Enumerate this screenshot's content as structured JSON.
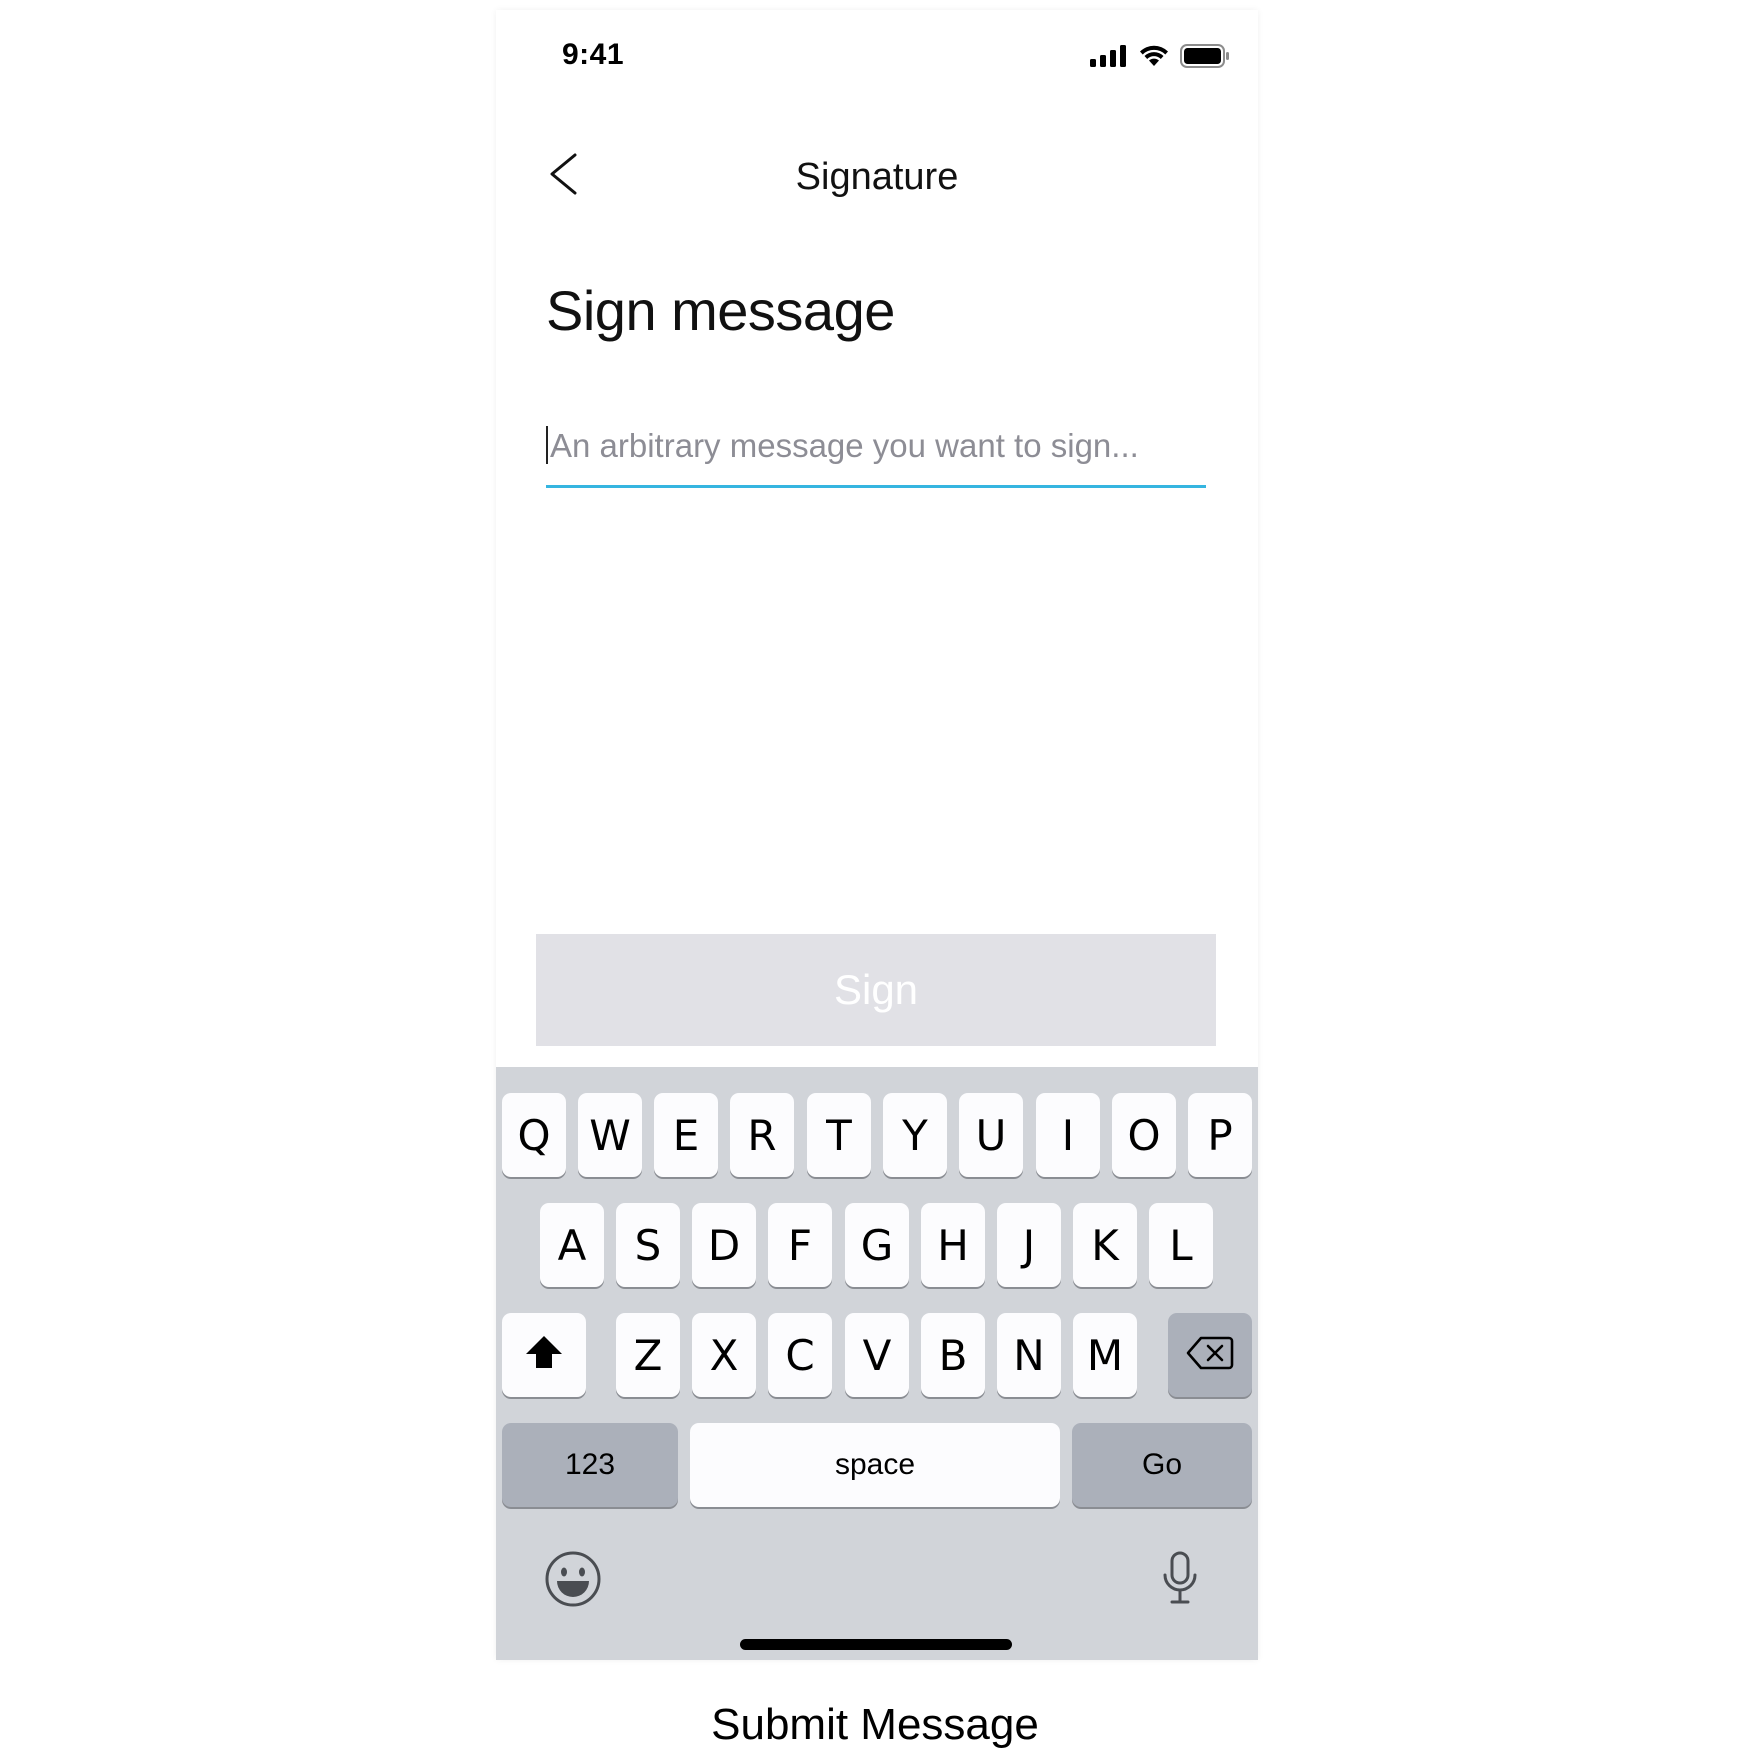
{
  "status_bar": {
    "time": "9:41",
    "icons": [
      "signal-icon",
      "wifi-icon",
      "battery-icon"
    ]
  },
  "nav": {
    "back_icon": "chevron-left-icon",
    "title": "Signature"
  },
  "page": {
    "heading": "Sign message"
  },
  "message_input": {
    "value": "",
    "placeholder": "An arbitrary message you want to sign..."
  },
  "sign_button": {
    "label": "Sign",
    "disabled": true
  },
  "keyboard": {
    "row1": [
      "Q",
      "W",
      "E",
      "R",
      "T",
      "Y",
      "U",
      "I",
      "O",
      "P"
    ],
    "row2": [
      "A",
      "S",
      "D",
      "F",
      "G",
      "H",
      "J",
      "K",
      "L"
    ],
    "row3": [
      "Z",
      "X",
      "C",
      "V",
      "B",
      "N",
      "M"
    ],
    "shift_icon": "shift-icon",
    "delete_icon": "backspace-icon",
    "numbers_label": "123",
    "space_label": "space",
    "go_label": "Go",
    "emoji_icon": "emoji-icon",
    "mic_icon": "microphone-icon"
  },
  "caption": "Submit Message",
  "colors": {
    "input_underline": "#35b5e0",
    "button_disabled_bg": "#e1e1e6",
    "keyboard_bg": "#d1d4d9",
    "key_bg": "#fcfcfe",
    "key_dark_bg": "#abb0ba",
    "placeholder": "#8d8d95"
  }
}
